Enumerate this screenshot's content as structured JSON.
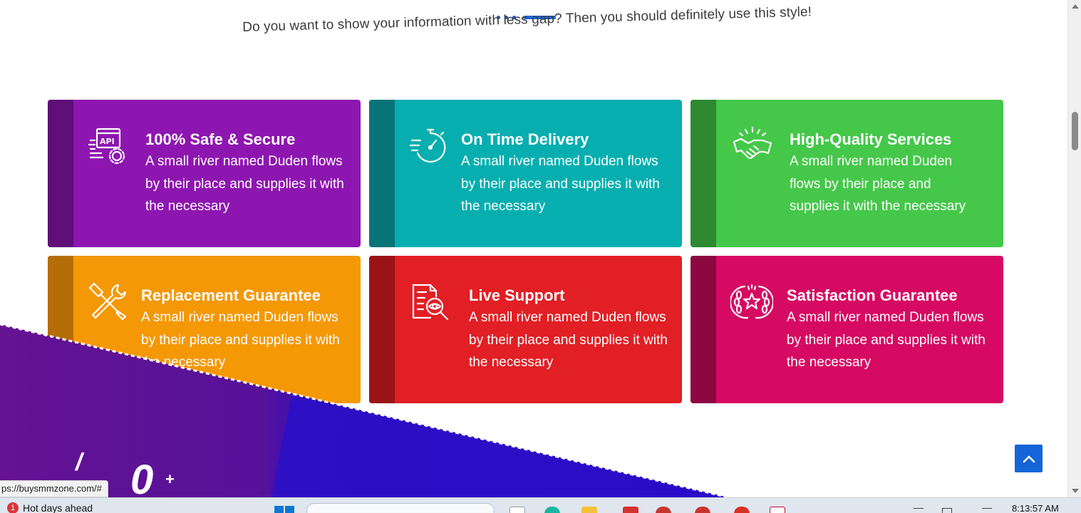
{
  "section": {
    "subtitle": "Do you want to show your information with less gap? Then you should definitely use this style!"
  },
  "colors": {
    "purple": "#8d16b0",
    "purple_stripe": "#5e0f78",
    "teal": "#06aeaf",
    "teal_stripe": "#087478",
    "green": "#45c74a",
    "green_stripe": "#2d8a31",
    "orange": "#f49806",
    "orange_stripe": "#b56d07",
    "red": "#e11f25",
    "red_stripe": "#9a1417",
    "magenta": "#d60a62",
    "magenta_stripe": "#8b0840",
    "wave_purple": "#6b1495",
    "wave_blue": "#2d0fc4",
    "back_to_top": "#1565d8"
  },
  "cards": [
    {
      "icon": "api-gear-icon",
      "title": "100% Safe & Secure",
      "desc": "A small river named Duden flows by their place and supplies it with the necessary"
    },
    {
      "icon": "stopwatch-icon",
      "title": "On Time Delivery",
      "desc": "A small river named Duden flows by their place and supplies it with the necessary"
    },
    {
      "icon": "handshake-icon",
      "title": "High-Quality Services",
      "desc": "A small river named Duden flows by their place and supplies it with the necessary"
    },
    {
      "icon": "tools-icon",
      "title": "Replacement Guarantee",
      "desc": "A small river named Duden flows by their place and supplies it with the necessary"
    },
    {
      "icon": "document-search-icon",
      "title": "Live Support",
      "desc": "A small river named Duden flows by their place and supplies it with the necessary"
    },
    {
      "icon": "laurel-star-icon",
      "title": "Satisfaction Guarantee",
      "desc": "A small river named Duden flows by their place and supplies it with the necessary"
    }
  ],
  "stats": {
    "slash": "/",
    "number": "0",
    "plus": "+"
  },
  "browser": {
    "status_url": "ps://buysmmzone.com/#"
  },
  "taskbar": {
    "weather_badge": "1",
    "weather_text": "Hot days ahead",
    "clock": "8:13:57 AM"
  }
}
